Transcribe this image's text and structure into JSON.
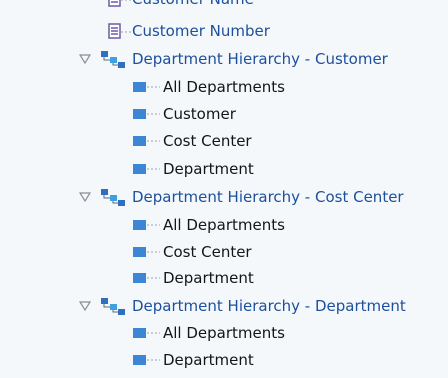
{
  "tree": {
    "attributes": [
      {
        "label": "Customer Name",
        "icon": "attribute-icon"
      },
      {
        "label": "Customer Number",
        "icon": "attribute-icon"
      }
    ],
    "hierarchies": [
      {
        "label": "Department Hierarchy - Customer",
        "icon": "hierarchy-icon",
        "expanded": true,
        "levels": [
          "All Departments",
          "Customer",
          "Cost Center",
          "Department"
        ]
      },
      {
        "label": "Department Hierarchy - Cost Center",
        "icon": "hierarchy-icon",
        "expanded": true,
        "levels": [
          "All Departments",
          "Cost Center",
          "Department"
        ]
      },
      {
        "label": "Department Hierarchy - Department",
        "icon": "hierarchy-icon",
        "expanded": true,
        "levels": [
          "All Departments",
          "Department"
        ]
      }
    ]
  },
  "colors": {
    "background": "#f5f8fb",
    "link_text": "#1d4f9c",
    "plain_text": "#151515",
    "level_icon": "#3d86d6",
    "toggle": "#8a8f96"
  }
}
